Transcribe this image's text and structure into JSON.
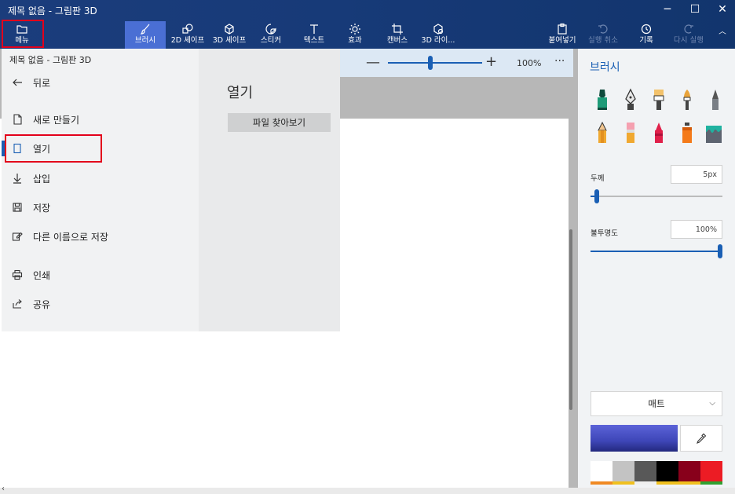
{
  "window": {
    "title": "제목 없음 - 그림판 3D",
    "controls": {
      "minimize": "─",
      "maximize": "☐",
      "close": "✕"
    }
  },
  "toolbar": {
    "menu": "메뉴",
    "brush": "브러시",
    "shapes2d": "2D 셰이프",
    "shapes3d": "3D 셰이프",
    "sticker": "스티커",
    "text": "텍스트",
    "effects": "효과",
    "canvas": "캔버스",
    "library3d": "3D 라이...",
    "paste": "붙여넣기",
    "undo": "실행 취소",
    "history": "기록",
    "redo": "다시 실행",
    "collapse": "︿"
  },
  "zoom": {
    "minus": "—",
    "plus": "+",
    "value": "100%",
    "more": "···",
    "level": 0.45
  },
  "menu": {
    "title": "제목 없음 - 그림판 3D",
    "items": {
      "back": "뒤로",
      "new": "새로 만들기",
      "open": "열기",
      "insert": "삽입",
      "save": "저장",
      "saveas": "다른 이름으로 저장",
      "print": "인쇄",
      "share": "공유"
    },
    "active_item": "open"
  },
  "open_panel": {
    "heading": "열기",
    "browse_button": "파일 찾아보기"
  },
  "sidebar": {
    "title": "브러시",
    "thickness": {
      "label": "두께",
      "value": "5px",
      "level": 0.03
    },
    "opacity": {
      "label": "불투명도",
      "value": "100%",
      "level": 1.0
    },
    "finish": {
      "value": "매트",
      "chevron": "⌵"
    },
    "selected_color": "#4048c0",
    "palette": [
      "#ffffff",
      "#c3c3c3",
      "#585858",
      "#000000",
      "#88001b",
      "#ec1c24"
    ],
    "palette_underline": [
      "#f08a24",
      "#f0c020",
      "#f0f0f0",
      "#f0c020",
      "#f0c020",
      "#30a030"
    ],
    "brushes": [
      "marker-icon",
      "calligraphy-pen-icon",
      "oil-brush-icon",
      "watercolor-icon",
      "pixel-pen-icon",
      "pencil-icon",
      "eraser-icon",
      "crayon-icon",
      "spray-can-icon",
      "fill-bucket-icon"
    ]
  },
  "colors": {
    "accent": "#1a5fb4",
    "highlight_box": "#e3001b",
    "topbar": "#173a78",
    "active_tool": "#4a6fd4"
  },
  "scroll": {
    "left_arrow": "‹"
  }
}
